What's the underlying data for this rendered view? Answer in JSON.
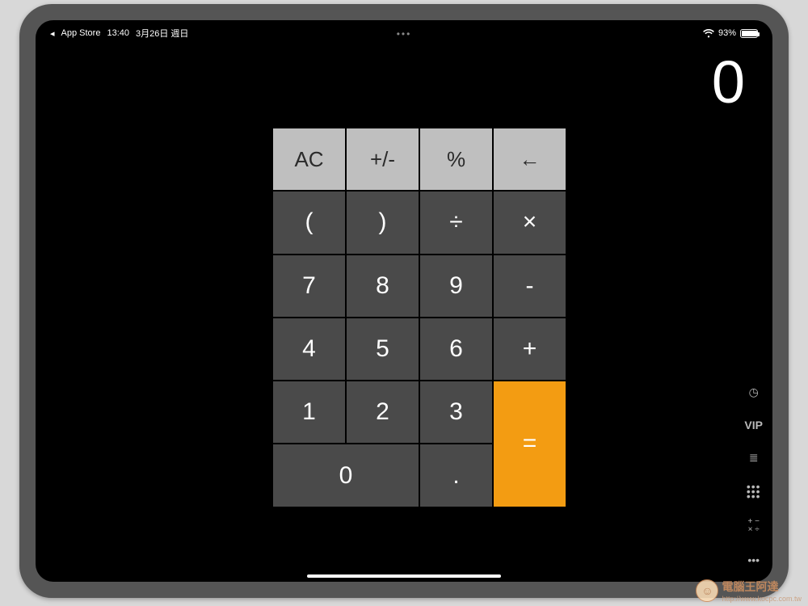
{
  "status": {
    "back_app": "App Store",
    "time": "13:40",
    "date": "3月26日 週日",
    "battery_pct": "93%",
    "battery_fill_pct": 93
  },
  "display": {
    "value": "0"
  },
  "keys": {
    "ac": "AC",
    "sign": "+/-",
    "percent": "%",
    "back": "←",
    "lparen": "(",
    "rparen": ")",
    "divide": "÷",
    "multiply": "×",
    "k7": "7",
    "k8": "8",
    "k9": "9",
    "minus": "-",
    "k4": "4",
    "k5": "5",
    "k6": "6",
    "plus": "+",
    "k1": "1",
    "k2": "2",
    "k3": "3",
    "k0": "0",
    "dot": ".",
    "equals": "="
  },
  "side": {
    "clock": "◷",
    "vip": "VIP",
    "list": "≣",
    "grid": "⠿",
    "sci": "+−\n×÷",
    "more": "•••"
  },
  "watermark": {
    "title": "電腦王阿達",
    "sub": "http://www.kocpc.com.tw"
  }
}
